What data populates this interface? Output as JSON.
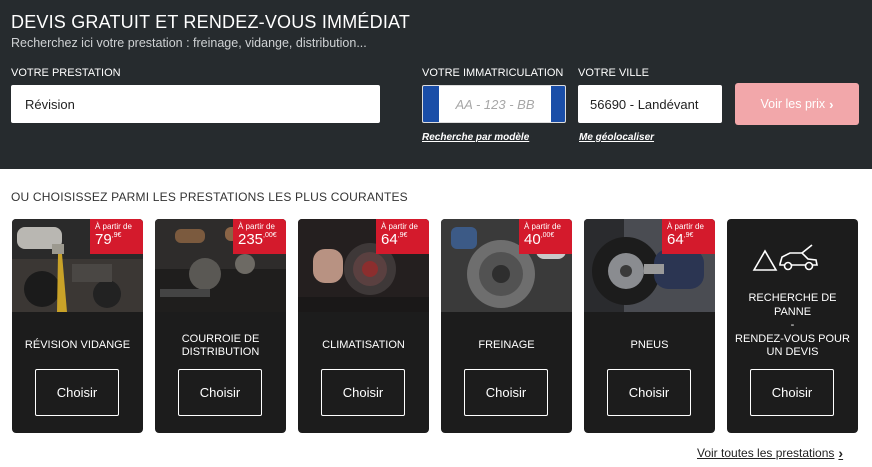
{
  "header": {
    "title": "DEVIS GRATUIT ET RENDEZ-VOUS IMMÉDIAT",
    "subtitle": "Recherchez ici votre prestation : freinage, vidange, distribution..."
  },
  "form": {
    "prestation_label": "VOTRE PRESTATION",
    "prestation_value": "Révision",
    "immat_label": "VOTRE IMMATRICULATION",
    "immat_placeholder": "AA - 123 - BB",
    "ville_label": "VOTRE VILLE",
    "ville_value": "56690 - Landévant",
    "submit_label": "Voir les prix",
    "link_modele": "Recherche par modèle",
    "link_geoloc": "Me géolocaliser"
  },
  "section_title": "OU CHOISISSEZ PARMI LES PRESTATIONS LES PLUS COURANTES",
  "cards": [
    {
      "title": "RÉVISION VIDANGE",
      "price_prefix": "À partir de",
      "price_int": "79",
      "price_dec": ",9€",
      "button": "Choisir"
    },
    {
      "title": "COURROIE DE DISTRIBUTION",
      "price_prefix": "À partir de",
      "price_int": "235",
      "price_dec": ",00€",
      "button": "Choisir"
    },
    {
      "title": "CLIMATISATION",
      "price_prefix": "À partir de",
      "price_int": "64",
      "price_dec": ",9€",
      "button": "Choisir"
    },
    {
      "title": "FREINAGE",
      "price_prefix": "À partir de",
      "price_int": "40",
      "price_dec": ",00€",
      "button": "Choisir"
    },
    {
      "title": "PNEUS",
      "price_prefix": "À partir de",
      "price_int": "64",
      "price_dec": ",9€",
      "button": "Choisir"
    }
  ],
  "panne_card": {
    "title_1": "RECHERCHE DE PANNE",
    "title_2": "-",
    "title_3": "RENDEZ-VOUS POUR UN DEVIS",
    "icon": "breakdown-car-icon",
    "button": "Choisir"
  },
  "footer_link": "Voir toutes les prestations",
  "colors": {
    "header_bg": "#262b2e",
    "price_red": "#d41a2c",
    "cta_pink": "#f2a7aa",
    "card_bg": "#1c1c1c",
    "plate_blue": "#1a4ea8"
  }
}
